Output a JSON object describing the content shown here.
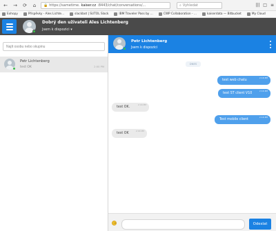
{
  "browser": {
    "url_prefix": "https://sametime.",
    "url_domain": "kaiser.cz",
    "url_suffix": ":8443/chat/conversations/...",
    "search_placeholder": "Vyhledat",
    "icons": [
      "back-icon",
      "forward-icon",
      "refresh-icon",
      "home-icon",
      "lock-icon",
      "search-icon",
      "library-icon",
      "reader-icon",
      "menu-icon"
    ]
  },
  "bookmarks": [
    "Exhopy",
    "Příspěvky - Ales Lichte...",
    "slackbot | SUTOL Slack",
    "IBM Traveler Pass by ...",
    "CWP Collaboration - ...",
    "kaiserdata — Bitbucket",
    "My Cloud"
  ],
  "header": {
    "title": "Dobrý den uživateli Ales Lichtenberg",
    "status": "Jsem k dispozici ▾"
  },
  "sidebar": {
    "search_placeholder": "Najít osobu nebo skupinu",
    "contact": {
      "name": "Petr Lichtenberg",
      "last_message": "test OK",
      "time": "2:00 PM"
    }
  },
  "chat": {
    "name": "Petr Lichtenberg",
    "status": "Jsem k dispozici",
    "day_label": "DNES"
  },
  "messages": [
    {
      "text": "test  web chatu",
      "time": "2:16 PM",
      "direction": "outgoing"
    },
    {
      "text": "test ST client V10",
      "time": "2:16 PM",
      "direction": "outgoing"
    },
    {
      "text": "test OK.",
      "time": "2:16 PM",
      "direction": "incoming"
    },
    {
      "text": "Test mobile client",
      "time": "2:16 PM",
      "direction": "outgoing"
    },
    {
      "text": "test OK",
      "time": "2:00 PM",
      "direction": "incoming"
    }
  ],
  "composer": {
    "send_label": "Odeslat"
  },
  "colors": {
    "accent": "#1b82e3",
    "outgoing_bubble": "#4fa0ec",
    "incoming_bubble": "#eaeaea",
    "topbar": "#4a4a4a",
    "status_green": "#3bbf4a"
  }
}
